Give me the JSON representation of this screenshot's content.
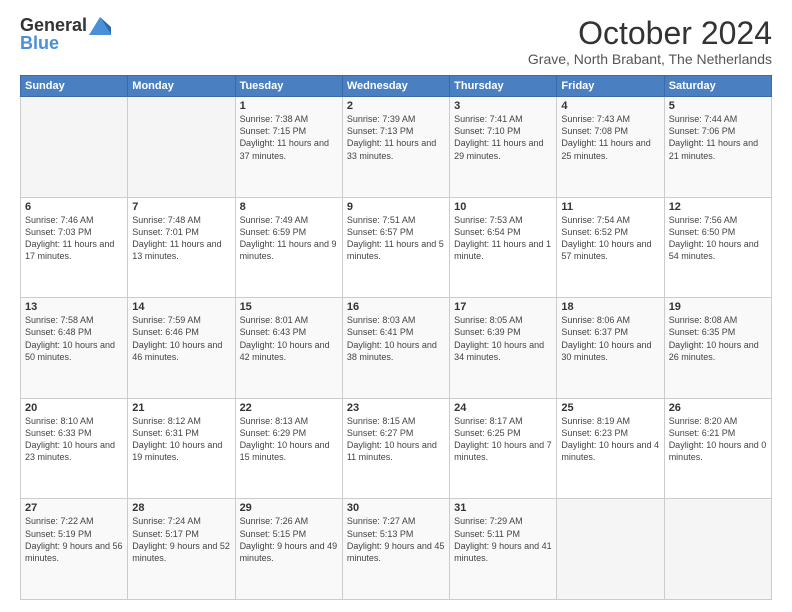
{
  "header": {
    "logo_line1": "General",
    "logo_line2": "Blue",
    "month_title": "October 2024",
    "subtitle": "Grave, North Brabant, The Netherlands"
  },
  "weekdays": [
    "Sunday",
    "Monday",
    "Tuesday",
    "Wednesday",
    "Thursday",
    "Friday",
    "Saturday"
  ],
  "weeks": [
    [
      {
        "day": "",
        "info": ""
      },
      {
        "day": "",
        "info": ""
      },
      {
        "day": "1",
        "info": "Sunrise: 7:38 AM\nSunset: 7:15 PM\nDaylight: 11 hours and 37 minutes."
      },
      {
        "day": "2",
        "info": "Sunrise: 7:39 AM\nSunset: 7:13 PM\nDaylight: 11 hours and 33 minutes."
      },
      {
        "day": "3",
        "info": "Sunrise: 7:41 AM\nSunset: 7:10 PM\nDaylight: 11 hours and 29 minutes."
      },
      {
        "day": "4",
        "info": "Sunrise: 7:43 AM\nSunset: 7:08 PM\nDaylight: 11 hours and 25 minutes."
      },
      {
        "day": "5",
        "info": "Sunrise: 7:44 AM\nSunset: 7:06 PM\nDaylight: 11 hours and 21 minutes."
      }
    ],
    [
      {
        "day": "6",
        "info": "Sunrise: 7:46 AM\nSunset: 7:03 PM\nDaylight: 11 hours and 17 minutes."
      },
      {
        "day": "7",
        "info": "Sunrise: 7:48 AM\nSunset: 7:01 PM\nDaylight: 11 hours and 13 minutes."
      },
      {
        "day": "8",
        "info": "Sunrise: 7:49 AM\nSunset: 6:59 PM\nDaylight: 11 hours and 9 minutes."
      },
      {
        "day": "9",
        "info": "Sunrise: 7:51 AM\nSunset: 6:57 PM\nDaylight: 11 hours and 5 minutes."
      },
      {
        "day": "10",
        "info": "Sunrise: 7:53 AM\nSunset: 6:54 PM\nDaylight: 11 hours and 1 minute."
      },
      {
        "day": "11",
        "info": "Sunrise: 7:54 AM\nSunset: 6:52 PM\nDaylight: 10 hours and 57 minutes."
      },
      {
        "day": "12",
        "info": "Sunrise: 7:56 AM\nSunset: 6:50 PM\nDaylight: 10 hours and 54 minutes."
      }
    ],
    [
      {
        "day": "13",
        "info": "Sunrise: 7:58 AM\nSunset: 6:48 PM\nDaylight: 10 hours and 50 minutes."
      },
      {
        "day": "14",
        "info": "Sunrise: 7:59 AM\nSunset: 6:46 PM\nDaylight: 10 hours and 46 minutes."
      },
      {
        "day": "15",
        "info": "Sunrise: 8:01 AM\nSunset: 6:43 PM\nDaylight: 10 hours and 42 minutes."
      },
      {
        "day": "16",
        "info": "Sunrise: 8:03 AM\nSunset: 6:41 PM\nDaylight: 10 hours and 38 minutes."
      },
      {
        "day": "17",
        "info": "Sunrise: 8:05 AM\nSunset: 6:39 PM\nDaylight: 10 hours and 34 minutes."
      },
      {
        "day": "18",
        "info": "Sunrise: 8:06 AM\nSunset: 6:37 PM\nDaylight: 10 hours and 30 minutes."
      },
      {
        "day": "19",
        "info": "Sunrise: 8:08 AM\nSunset: 6:35 PM\nDaylight: 10 hours and 26 minutes."
      }
    ],
    [
      {
        "day": "20",
        "info": "Sunrise: 8:10 AM\nSunset: 6:33 PM\nDaylight: 10 hours and 23 minutes."
      },
      {
        "day": "21",
        "info": "Sunrise: 8:12 AM\nSunset: 6:31 PM\nDaylight: 10 hours and 19 minutes."
      },
      {
        "day": "22",
        "info": "Sunrise: 8:13 AM\nSunset: 6:29 PM\nDaylight: 10 hours and 15 minutes."
      },
      {
        "day": "23",
        "info": "Sunrise: 8:15 AM\nSunset: 6:27 PM\nDaylight: 10 hours and 11 minutes."
      },
      {
        "day": "24",
        "info": "Sunrise: 8:17 AM\nSunset: 6:25 PM\nDaylight: 10 hours and 7 minutes."
      },
      {
        "day": "25",
        "info": "Sunrise: 8:19 AM\nSunset: 6:23 PM\nDaylight: 10 hours and 4 minutes."
      },
      {
        "day": "26",
        "info": "Sunrise: 8:20 AM\nSunset: 6:21 PM\nDaylight: 10 hours and 0 minutes."
      }
    ],
    [
      {
        "day": "27",
        "info": "Sunrise: 7:22 AM\nSunset: 5:19 PM\nDaylight: 9 hours and 56 minutes."
      },
      {
        "day": "28",
        "info": "Sunrise: 7:24 AM\nSunset: 5:17 PM\nDaylight: 9 hours and 52 minutes."
      },
      {
        "day": "29",
        "info": "Sunrise: 7:26 AM\nSunset: 5:15 PM\nDaylight: 9 hours and 49 minutes."
      },
      {
        "day": "30",
        "info": "Sunrise: 7:27 AM\nSunset: 5:13 PM\nDaylight: 9 hours and 45 minutes."
      },
      {
        "day": "31",
        "info": "Sunrise: 7:29 AM\nSunset: 5:11 PM\nDaylight: 9 hours and 41 minutes."
      },
      {
        "day": "",
        "info": ""
      },
      {
        "day": "",
        "info": ""
      }
    ]
  ]
}
